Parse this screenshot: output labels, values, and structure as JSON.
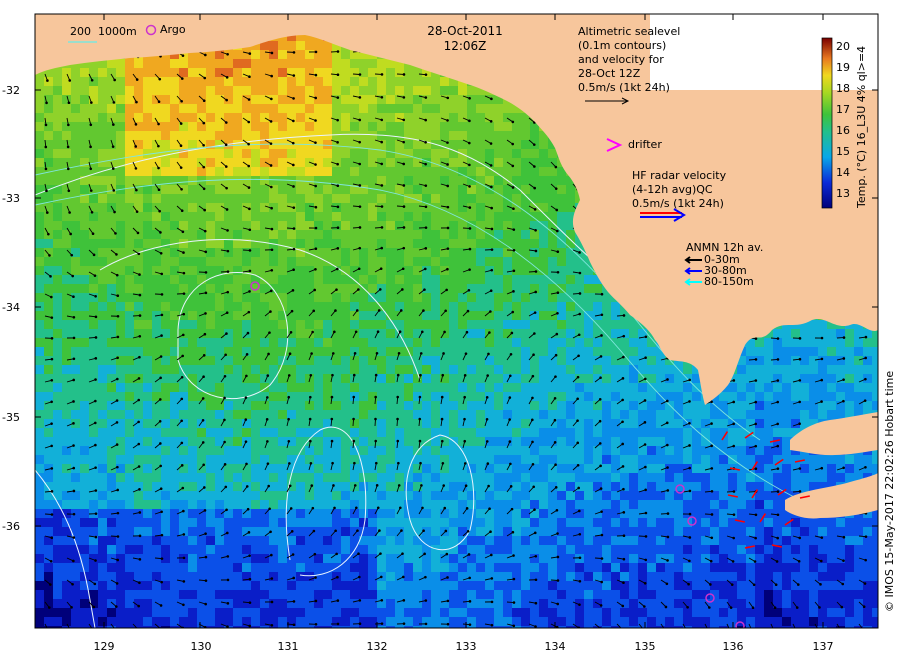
{
  "header": {
    "date": "28-Oct-2011",
    "time": "12:06Z"
  },
  "legend": {
    "isobath_200": "200",
    "isobath_1000": "1000m",
    "argo": "Argo",
    "drifter": "drifter",
    "altimetry": [
      "Altimetric sealevel",
      "(0.1m contours)",
      "and velocity for",
      "28-Oct 12Z",
      "0.5m/s (1kt 24h)"
    ],
    "hf_radar": [
      "HF radar velocity",
      "(4-12h avg)QC",
      "0.5m/s (1kt 24h)"
    ],
    "anmn": [
      "ANMN 12h av.",
      "0-30m",
      "30-80m",
      "80-150m"
    ]
  },
  "axes": {
    "x_ticks": [
      "129",
      "130",
      "131",
      "132",
      "133",
      "134",
      "135",
      "136",
      "137"
    ],
    "y_ticks": [
      "-32",
      "-33",
      "-34",
      "-35",
      "-36"
    ]
  },
  "colorbar": {
    "ticks": [
      "20",
      "19",
      "18",
      "17",
      "16",
      "15",
      "14",
      "13"
    ],
    "label": "Temp. (°C) 16_L3U 4% ql>=4",
    "range": [
      12.5,
      20.5
    ]
  },
  "credit": "© IMOS 15-May-2017 22:02:26 Hobart time",
  "colors": {
    "land": "#f7c69c",
    "isobath": "#7fe6dc",
    "sealevel_contour": "#e8f4ff",
    "argo": "#cc33cc",
    "drifter": "#ff00ff",
    "hf_arrow_red": "#ff0000",
    "hf_arrow_blue": "#0000ff",
    "anmn_black": "#000000",
    "anmn_blue": "#0000ff",
    "anmn_cyan": "#00ffff"
  }
}
